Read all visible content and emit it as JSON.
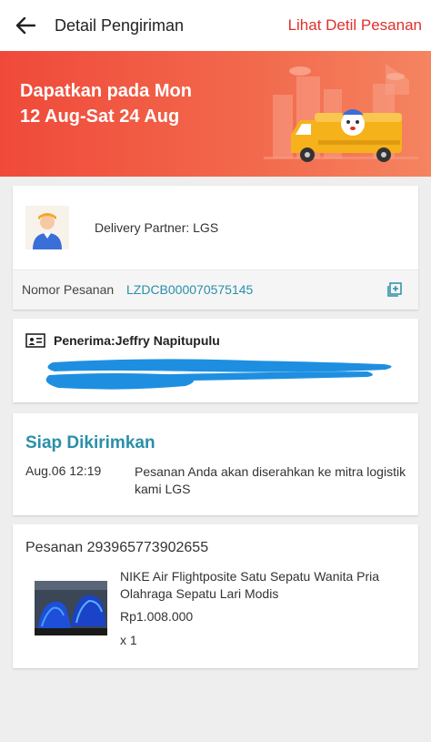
{
  "header": {
    "back_icon": "arrow-left-icon",
    "title": "Detail Pengiriman",
    "link": "Lihat Detil Pesanan"
  },
  "banner": {
    "line1": "Dapatkan pada Mon",
    "line2": "12 Aug-Sat 24 Aug"
  },
  "partner": {
    "label": "Delivery Partner: LGS",
    "order_label": "Nomor Pesanan",
    "order_number": "LZDCB000070575145"
  },
  "recipient": {
    "label": "Penerima:Jeffry Napitupulu"
  },
  "status": {
    "title": "Siap Dikirimkan",
    "time": "Aug.06 12:19",
    "description": "Pesanan Anda akan diserahkan ke mitra logistik kami LGS"
  },
  "order": {
    "title": "Pesanan 293965773902655",
    "product_name": "NIKE Air Flightposite Satu Sepatu Wanita Pria Olahraga Sepatu Lari Modis",
    "price": "Rp1.008.000",
    "quantity": "x 1"
  },
  "colors": {
    "accent_red": "#e0302a",
    "banner_red": "#f0493a",
    "teal": "#2a8fa8",
    "scribble_blue": "#1e8fe0"
  }
}
